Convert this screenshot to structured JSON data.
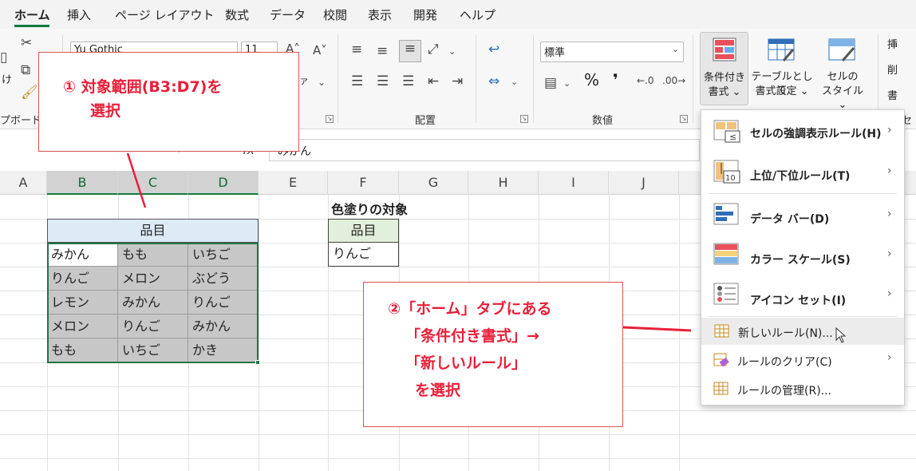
{
  "ribbon_tabs": [
    "ホーム",
    "挿入",
    "ページ レイアウト",
    "数式",
    "データ",
    "校閲",
    "表示",
    "開発",
    "ヘルプ"
  ],
  "ribbon": {
    "clipboard_label": "プボード",
    "paste_label": "け",
    "font_name": "Yu Gothic",
    "font_size": "11",
    "phonetic_label": "ア",
    "alignment_label": "配置",
    "number_label": "数値",
    "number_format": "標準",
    "percent": "%",
    "comma": "❜",
    "cond_format_line1": "条件付き",
    "cond_format_line2": "書式 ⌄",
    "table_line1": "テーブルとして",
    "table_line2": "書式設定 ⌄",
    "cell_style_line1": "セルの",
    "cell_style_line2": "スタイル ⌄",
    "right_edge_1": "挿",
    "right_edge_2": "削",
    "right_edge_3": "書",
    "right_edge_4": "セ"
  },
  "formula_bar": {
    "name_dots": "⁝",
    "fx": "fx",
    "content": "みかん"
  },
  "columns": [
    "A",
    "B",
    "C",
    "D",
    "E",
    "F",
    "G",
    "H",
    "I",
    "J"
  ],
  "table_b": {
    "header": "品目",
    "rows": [
      [
        "みかん",
        "もも",
        "いちご"
      ],
      [
        "りんご",
        "メロン",
        "ぶどう"
      ],
      [
        "レモン",
        "みかん",
        "りんご"
      ],
      [
        "メロン",
        "りんご",
        "みかん"
      ],
      [
        "もも",
        "いちご",
        "かき"
      ]
    ]
  },
  "table_f": {
    "title": "色塗りの対象",
    "header": "品目",
    "value": "りんご"
  },
  "callout1": {
    "line1": "① 対象範囲(B3:D7)を",
    "line2": "選択"
  },
  "callout2": {
    "line1": "②「ホーム」タブにある",
    "line2": "「条件付き書式」→",
    "line3": "「新しいルール」",
    "line4": "を選択"
  },
  "menu": {
    "items": [
      {
        "label": "セルの強調表示ルール(H)",
        "icon": "highlight-rules-icon"
      },
      {
        "label": "上位/下位ルール(T)",
        "icon": "top-bottom-icon"
      },
      {
        "label": "データ バー(D)",
        "icon": "data-bars-icon"
      },
      {
        "label": "カラー スケール(S)",
        "icon": "color-scales-icon"
      },
      {
        "label": "アイコン セット(I)",
        "icon": "icon-sets-icon"
      }
    ],
    "new_rule": "新しいルール(N)...",
    "clear_rules": "ルールのクリア(C)",
    "manage_rules": "ルールの管理(R)...",
    "arrow": "›"
  },
  "colors": {
    "accent": "#107c41",
    "callout": "#e8203a",
    "header_blue": "#ddebf7",
    "header_green": "#e2efda",
    "cell_gray": "#c7c7c7"
  }
}
